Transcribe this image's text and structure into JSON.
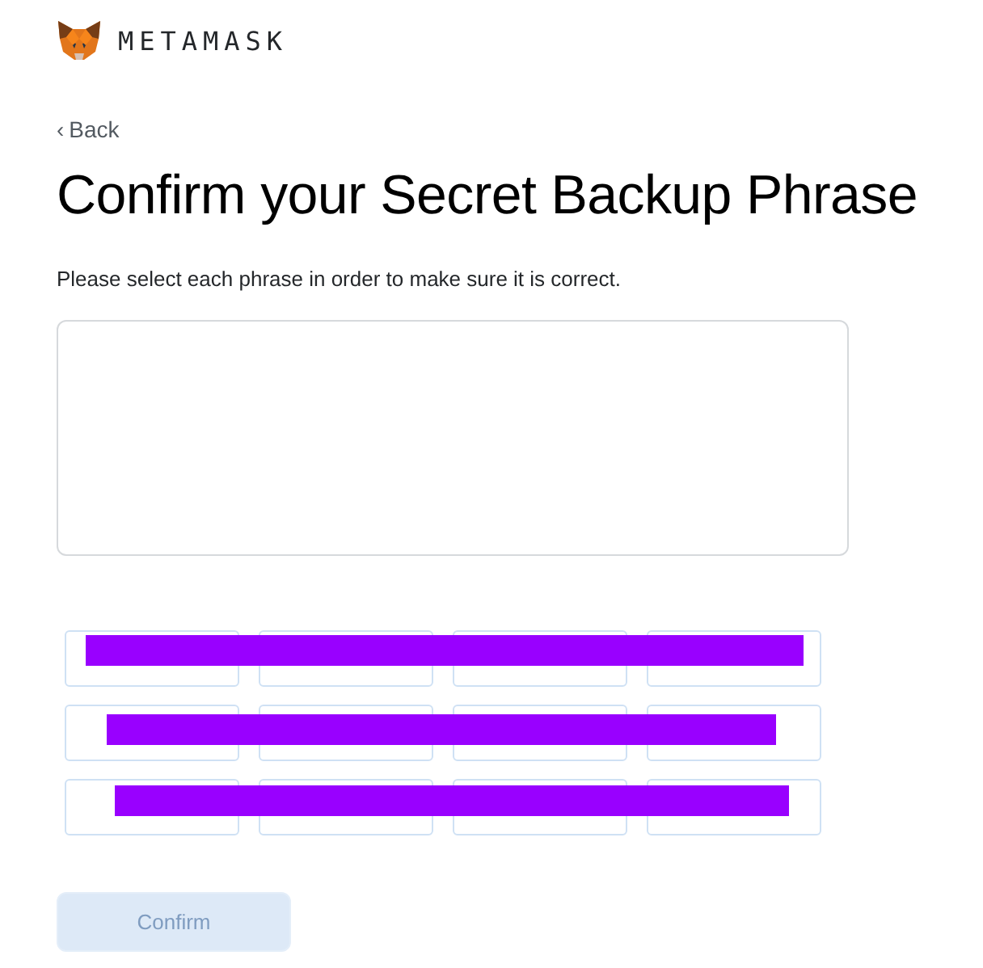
{
  "header": {
    "brand": "METAMASK"
  },
  "back_link": {
    "arrow": "‹",
    "label": "Back"
  },
  "title": "Confirm your Secret Backup Phrase",
  "instruction": "Please select each phrase in order to make sure it is correct.",
  "word_rows": [
    {
      "redacted": true,
      "chips": [
        {
          "kind": "word"
        },
        {
          "kind": "word"
        },
        {
          "kind": "word"
        },
        {
          "kind": "word"
        }
      ]
    },
    {
      "redacted": true,
      "chips": [
        {
          "kind": "word"
        },
        {
          "kind": "word"
        },
        {
          "kind": "word"
        },
        {
          "kind": "word"
        }
      ]
    },
    {
      "redacted": true,
      "chips": [
        {
          "kind": "word"
        },
        {
          "kind": "word"
        },
        {
          "kind": "word"
        },
        {
          "kind": "word"
        }
      ]
    }
  ],
  "confirm_button": {
    "label": "Confirm",
    "disabled": true
  }
}
